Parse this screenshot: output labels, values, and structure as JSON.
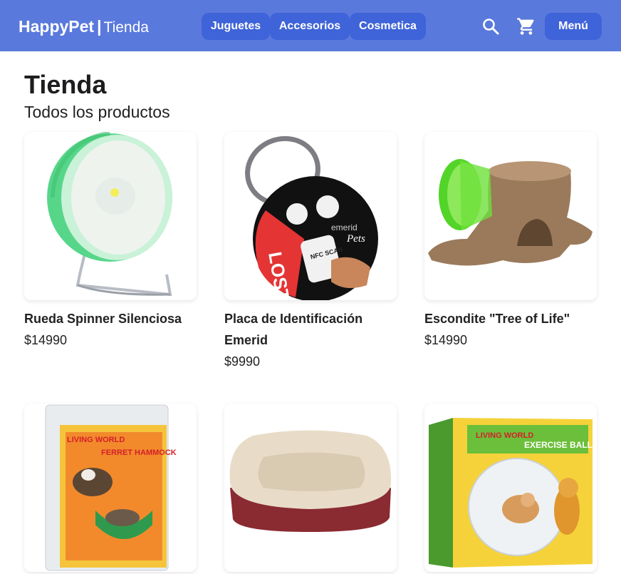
{
  "header": {
    "brand": "HappyPet",
    "separator": "|",
    "section": "Tienda",
    "nav": [
      "Juguetes",
      "Accesorios",
      "Cosmetica"
    ],
    "menu_label": "Menú",
    "icons": [
      "search-icon",
      "cart-icon"
    ]
  },
  "page": {
    "title": "Tienda",
    "subtitle": "Todos los productos"
  },
  "products": [
    {
      "name": "Rueda Spinner Silenciosa",
      "price": "$14990"
    },
    {
      "name": "Placa de Identificación Emerid",
      "price": "$9990"
    },
    {
      "name": "Escondite \"Tree of Life\"",
      "price": "$14990"
    },
    {
      "name": "",
      "price": ""
    },
    {
      "name": "",
      "price": ""
    },
    {
      "name": "",
      "price": ""
    }
  ],
  "product_image_text": {
    "tag_lost": "LOST",
    "tag_nfc": "NFC SCAN",
    "tag_brand": "emerid",
    "tag_pets": "Pets",
    "living_world": "LIVING WORLD",
    "hammock": "FERRET HAMMOCK",
    "exercise": "EXERCISE BALL"
  },
  "colors": {
    "header_bg": "#5a79dc",
    "button_bg": "#3f63d9",
    "text": "#1d1d1f"
  }
}
